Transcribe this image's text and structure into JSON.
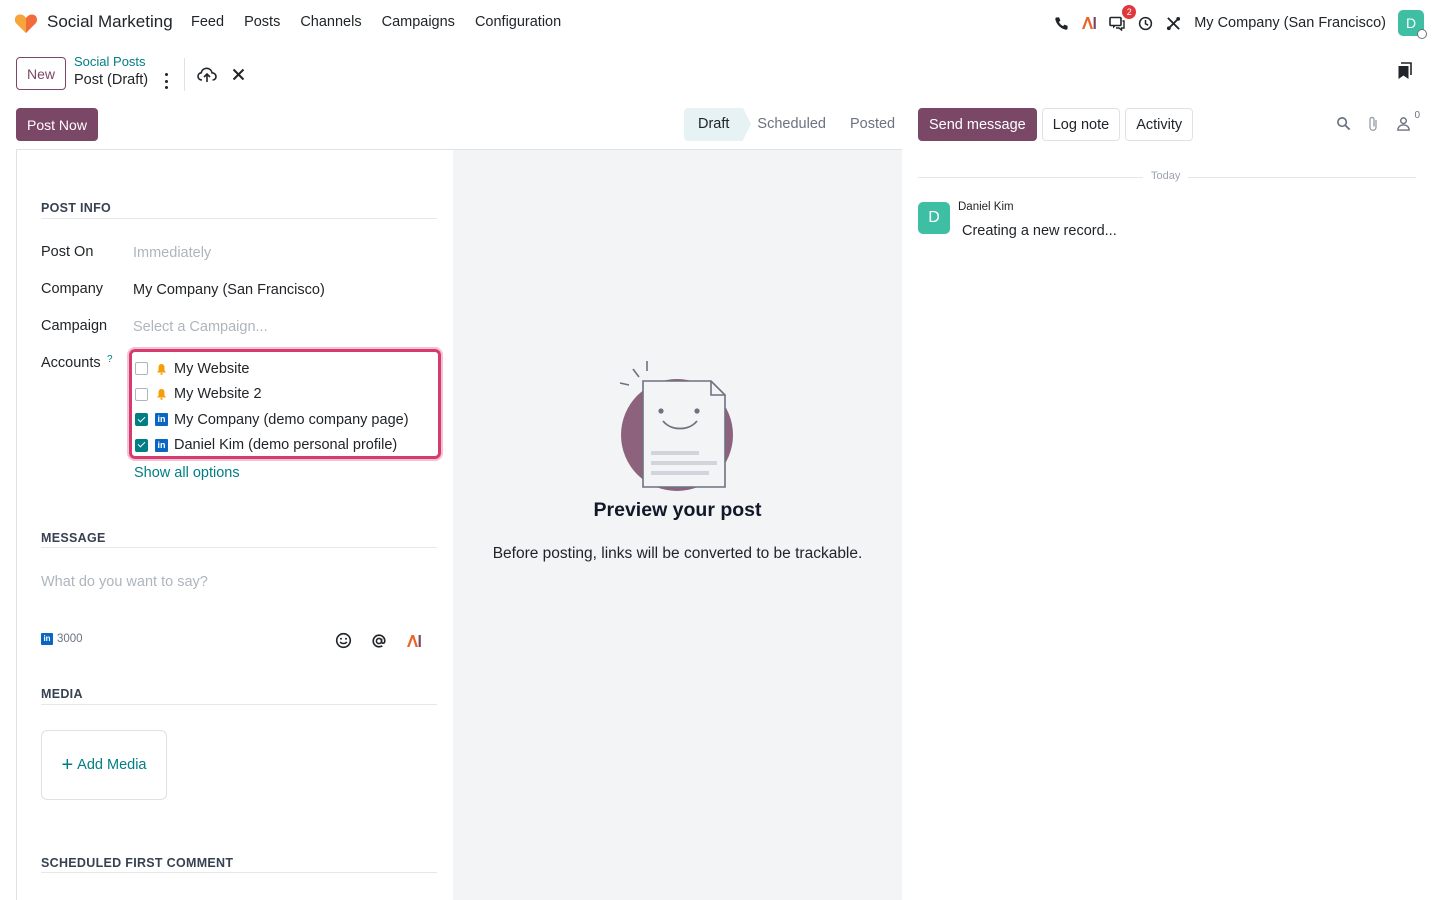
{
  "navbar": {
    "app_name": "Social Marketing",
    "menu": [
      "Feed",
      "Posts",
      "Channels",
      "Campaigns",
      "Configuration"
    ],
    "messages_badge": "2",
    "company": "My Company (San Francisco)",
    "avatar_letter": "D"
  },
  "control_panel": {
    "new_label": "New",
    "breadcrumb_parent": "Social Posts",
    "breadcrumb_current": "Post (Draft)"
  },
  "actions": {
    "post_now": "Post Now",
    "statuses": [
      "Draft",
      "Scheduled",
      "Posted"
    ],
    "active_status": "Draft"
  },
  "chatter": {
    "send_message": "Send message",
    "log_note": "Log note",
    "activity": "Activity",
    "followers_count": "0",
    "date_separator": "Today",
    "messages": [
      {
        "author": "Daniel Kim",
        "avatar": "D",
        "body": "Creating a new record..."
      }
    ]
  },
  "form": {
    "post_info_title": "POST INFO",
    "post_on_label": "Post On",
    "post_on_placeholder": "Immediately",
    "company_label": "Company",
    "company_value": "My Company (San Francisco)",
    "campaign_label": "Campaign",
    "campaign_placeholder": "Select a Campaign...",
    "accounts_label": "Accounts",
    "accounts_help": "?",
    "accounts": [
      {
        "name": "My Website",
        "checked": false,
        "type": "website"
      },
      {
        "name": "My Website 2",
        "checked": false,
        "type": "website"
      },
      {
        "name": "My Company (demo company page)",
        "checked": true,
        "type": "linkedin"
      },
      {
        "name": "Daniel Kim (demo personal profile)",
        "checked": true,
        "type": "linkedin"
      }
    ],
    "show_all_options": "Show all options",
    "message_title": "MESSAGE",
    "message_placeholder": "What do you want to say?",
    "char_limit": "3000",
    "media_title": "MEDIA",
    "add_media": "Add Media",
    "first_comment_title": "SCHEDULED FIRST COMMENT"
  },
  "preview": {
    "title": "Preview your post",
    "text": "Before posting, links will be converted to be trackable."
  },
  "colors": {
    "brand": "#7a4866",
    "accent": "#017e84",
    "highlight_border": "#d63b6f",
    "avatar": "#3ebfa3"
  }
}
